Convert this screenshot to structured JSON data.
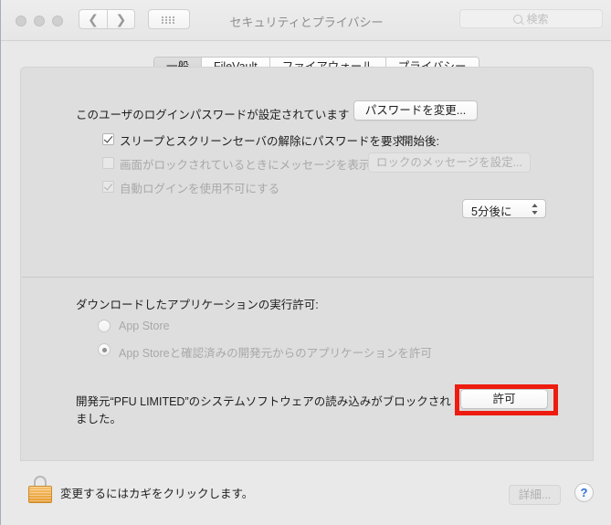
{
  "window": {
    "title": "セキュリティとプライバシー",
    "traffic_lights": [
      "close",
      "minimize",
      "zoom"
    ],
    "nav": {
      "back_icon": "chevron-left-icon",
      "forward_icon": "chevron-right-icon"
    },
    "grid_button_icon": "grid-dots-icon",
    "search": {
      "placeholder": "検索",
      "value": "",
      "icon": "search-icon"
    }
  },
  "tabs": [
    {
      "label": "一般",
      "selected": true
    },
    {
      "label": "FileVault",
      "selected": false
    },
    {
      "label": "ファイアウォール",
      "selected": false
    },
    {
      "label": "プライバシー",
      "selected": false
    }
  ],
  "general": {
    "password_status": "このユーザのログインパスワードが設定されています",
    "change_password_button": "パスワードを変更...",
    "require_password": {
      "label": "スリープとスクリーンセーバの解除にパスワードを要求",
      "checked": true,
      "enabled": true
    },
    "delay": {
      "label": "開始後:",
      "value": "5分後に",
      "stepper_icon": "chevron-up-down-icon"
    },
    "show_message": {
      "label": "画面がロックされているときにメッセージを表示",
      "checked": false,
      "enabled": false
    },
    "set_lock_message_button": "ロックのメッセージを設定...",
    "disable_auto_login": {
      "label": "自動ログインを使用不可にする",
      "checked": true,
      "enabled": false
    }
  },
  "download_section": {
    "heading": "ダウンロードしたアプリケーションの実行許可:",
    "options": [
      {
        "label": "App Store",
        "selected": false,
        "enabled": false
      },
      {
        "label": "App Storeと確認済みの開発元からのアプリケーションを許可",
        "selected": true,
        "enabled": false
      }
    ]
  },
  "blocked_notice": {
    "line1": "開発元“PFU LIMITED”のシステムソフトウェアの読み込みがブロックされ",
    "line2": "ました。",
    "allow_button": "許可",
    "highlight_color": "#ee1c10"
  },
  "footer": {
    "lock_icon": "padlock-closed-icon",
    "lock_label": "変更するにはカギをクリックします。",
    "details_button": "詳細...",
    "help_button": "?"
  }
}
